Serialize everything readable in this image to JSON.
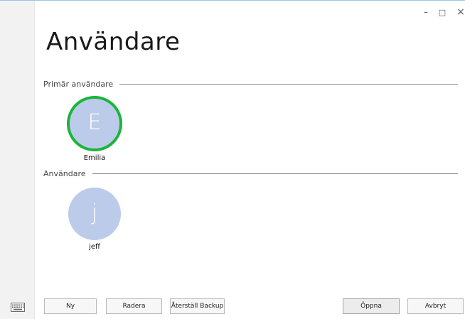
{
  "window": {
    "title": "Användare",
    "controls": {
      "minimize": "–",
      "maximize": "□",
      "close": "×"
    }
  },
  "sections": {
    "primary_label": "Primär användare",
    "users_label": "Användare"
  },
  "primary_user": {
    "initial": "E",
    "name": "Emilia",
    "selected": true,
    "ring_color": "#19b53a"
  },
  "users": [
    {
      "initial": "j",
      "name": "jeff"
    }
  ],
  "buttons": {
    "new": "Ny",
    "delete": "Radera",
    "restore_backup": "Återställ Backup",
    "open": "Öppna",
    "cancel": "Avbryt"
  },
  "icons": {
    "keyboard": "keyboard-icon"
  },
  "colors": {
    "avatar_bg": "#bccbea",
    "accent_green": "#19b53a"
  }
}
